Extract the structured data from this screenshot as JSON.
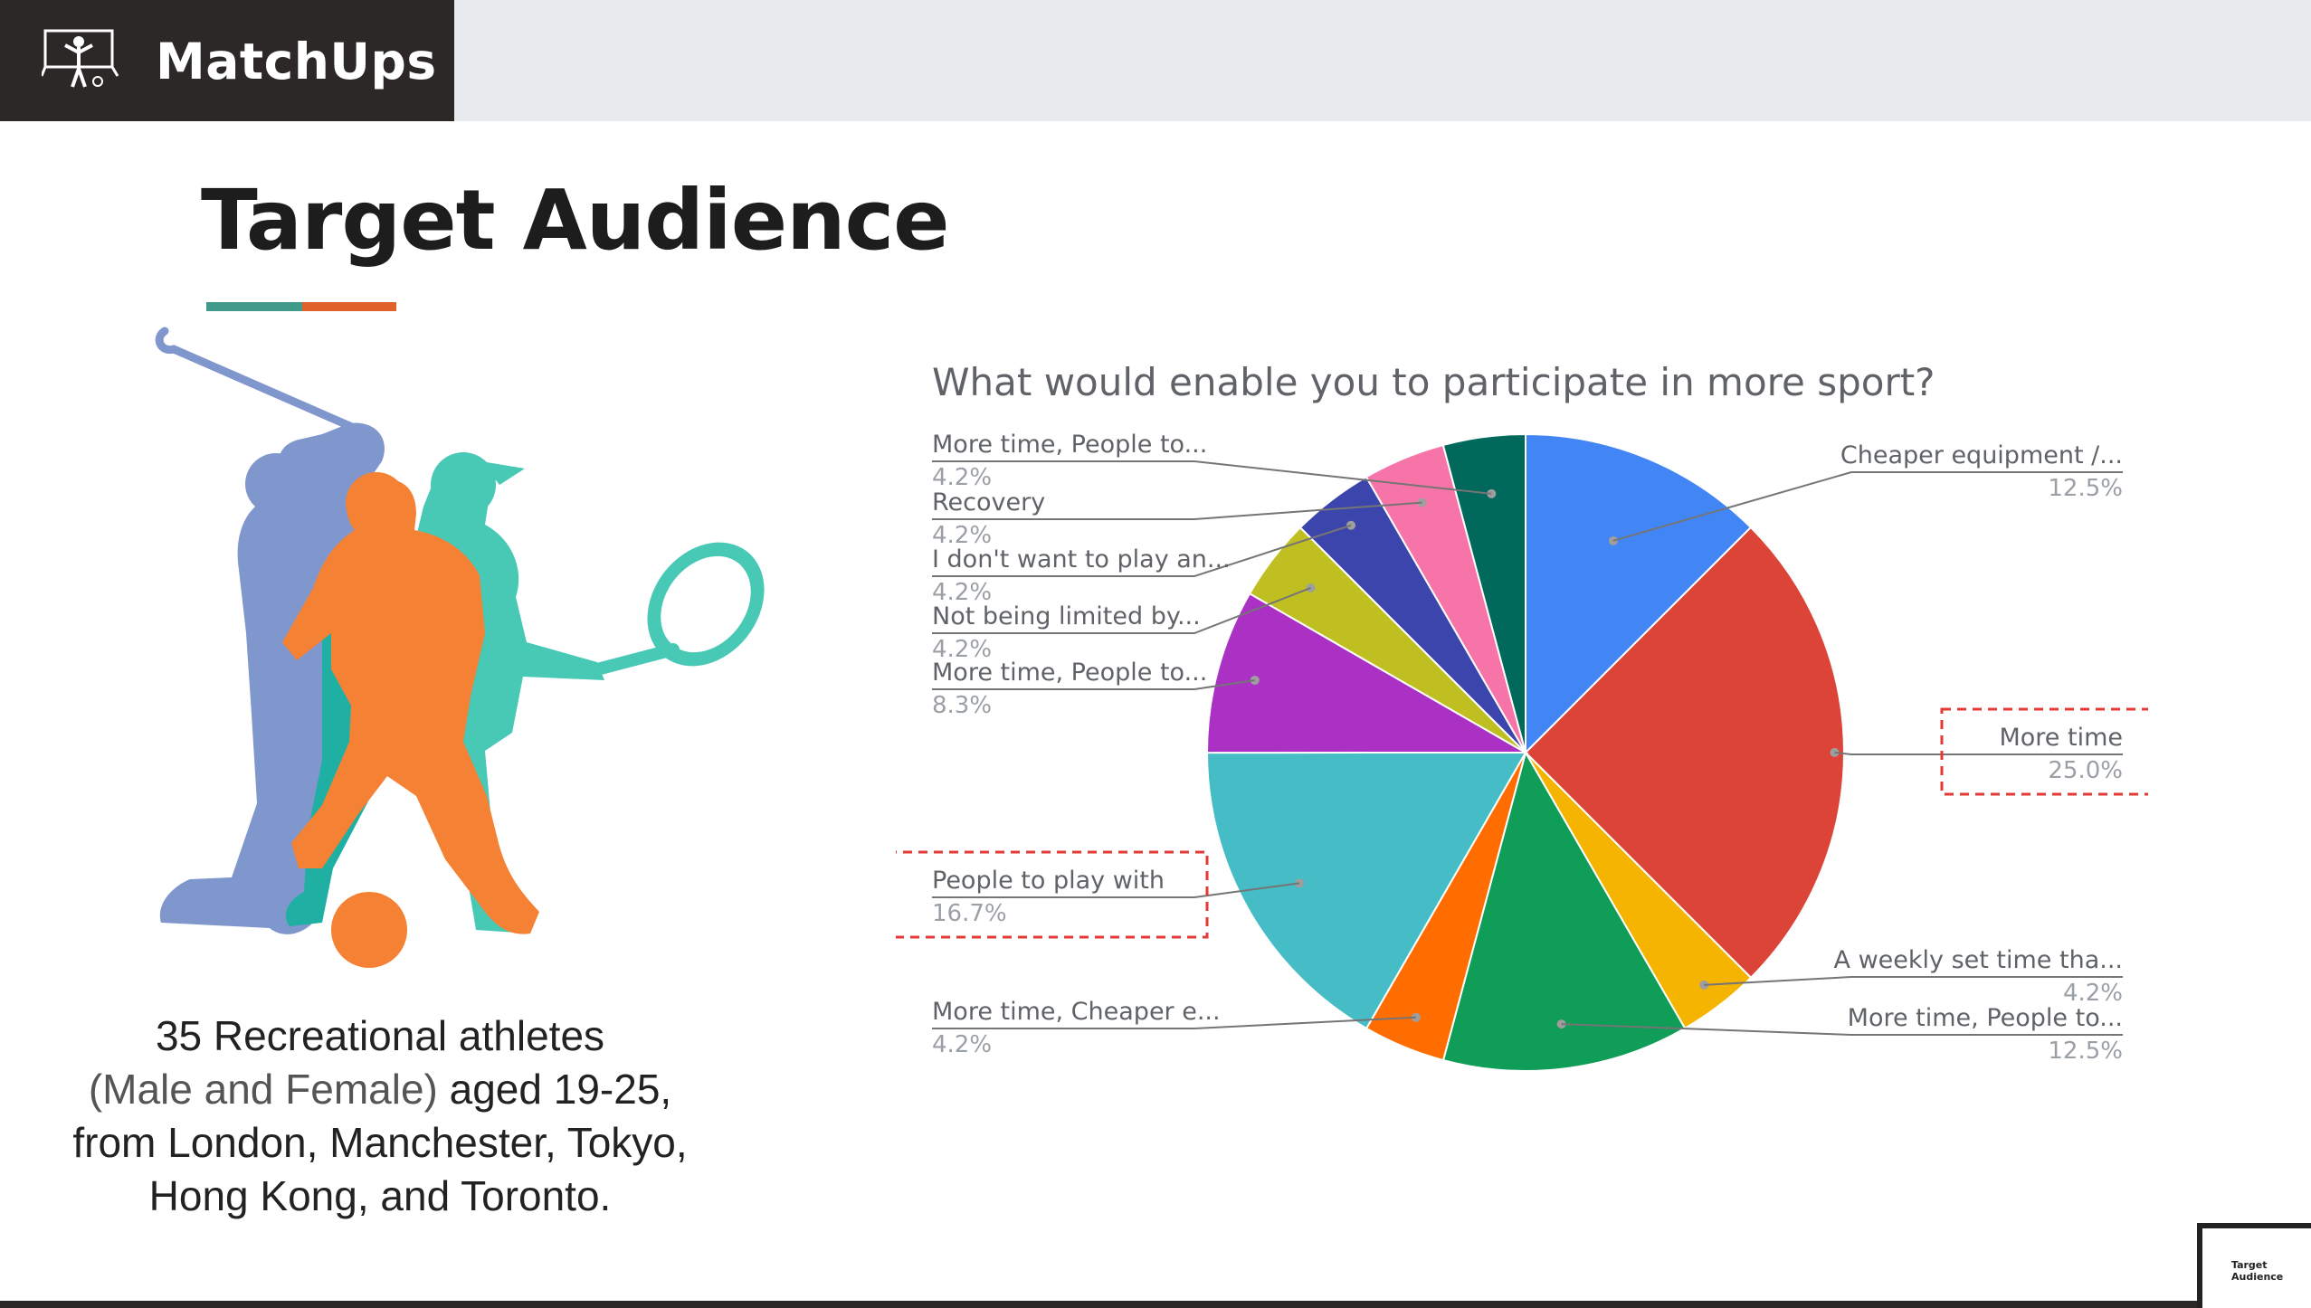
{
  "brand": {
    "name": "MatchUps",
    "icon": "goalkeeper-icon"
  },
  "slide": {
    "title": "Target Audience",
    "accent_colors": [
      "#3f9a8a",
      "#e0622b"
    ],
    "description": {
      "line1": "35 Recreational athletes",
      "line2_light": "(Male and Female)",
      "line2_rest": " aged 19-25,",
      "line3": "from London, Manchester, Tokyo,",
      "line4": "Hong Kong, and Toronto."
    }
  },
  "illustration": {
    "icon": "athletes-silhouette-icon",
    "colors": [
      "#7f97cc",
      "#f58134",
      "#47c9b6",
      "#1fb0a3"
    ]
  },
  "thumbnail": {
    "title": "Target Audience"
  },
  "chart_data": {
    "type": "pie",
    "title": "What would enable you to participate in more sport?",
    "slices": [
      {
        "label": "Cheaper equipment /...",
        "percent": "12.5%",
        "value": 12.5,
        "color": "#4285f4"
      },
      {
        "label": "More time",
        "percent": "25.0%",
        "value": 25.0,
        "color": "#db4437",
        "highlighted": true
      },
      {
        "label": "A weekly set time tha...",
        "percent": "4.2%",
        "value": 4.17,
        "color": "#f4b400"
      },
      {
        "label": "More time, People to...",
        "percent": "12.5%",
        "value": 12.5,
        "color": "#0f9d58"
      },
      {
        "label": "More time, Cheaper e...",
        "percent": "4.2%",
        "value": 4.17,
        "color": "#ff6d00"
      },
      {
        "label": "People to play with",
        "percent": "16.7%",
        "value": 16.67,
        "color": "#46bdc6",
        "highlighted": true
      },
      {
        "label": "More time, People to...",
        "percent": "8.3%",
        "value": 8.33,
        "color": "#ab30c4"
      },
      {
        "label": "Not being limited by...",
        "percent": "4.2%",
        "value": 4.17,
        "color": "#c0bf21"
      },
      {
        "label": "I don't want to play an...",
        "percent": "4.2%",
        "value": 4.17,
        "color": "#3b45ab"
      },
      {
        "label": "Recovery",
        "percent": "4.2%",
        "value": 4.17,
        "color": "#f774a8"
      },
      {
        "label": "More time, People to...",
        "percent": "4.2%",
        "value": 4.17,
        "color": "#00695c"
      }
    ]
  }
}
